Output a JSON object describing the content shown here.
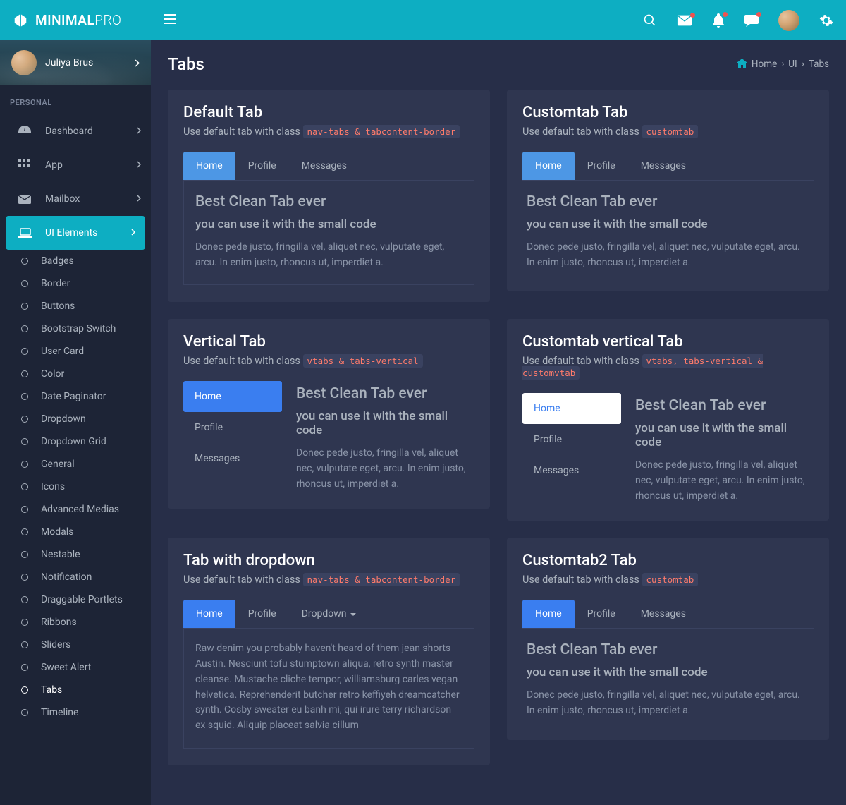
{
  "brand": {
    "text1": "MINIMAL",
    "text2": "PRO"
  },
  "user": {
    "name": "Juliya Brus"
  },
  "section_label": "PERSONAL",
  "nav": {
    "dashboard": "Dashboard",
    "app": "App",
    "mailbox": "Mailbox",
    "ui": "UI Elements"
  },
  "ui_children": [
    "Badges",
    "Border",
    "Buttons",
    "Bootstrap Switch",
    "User Card",
    "Color",
    "Date Paginator",
    "Dropdown",
    "Dropdown Grid",
    "General",
    "Icons",
    "Advanced Medias",
    "Modals",
    "Nestable",
    "Notification",
    "Draggable Portlets",
    "Ribbons",
    "Sliders",
    "Sweet Alert",
    "Tabs",
    "Timeline"
  ],
  "page": {
    "title": "Tabs"
  },
  "crumbs": {
    "home": "Home",
    "ui": "UI",
    "tabs": "Tabs"
  },
  "common": {
    "subprefix": "Use default tab with class ",
    "tab_home": "Home",
    "tab_profile": "Profile",
    "tab_messages": "Messages",
    "tab_dropdown": "Dropdown",
    "tc_h1": "Best Clean Tab ever",
    "tc_h2": "you can use it with the small code",
    "tc_p": "Donec pede justo, fringilla vel, aliquet nec, vulputate eget, arcu. In enim justo, rhoncus ut, imperdiet a."
  },
  "boxes": {
    "default": {
      "title": "Default Tab",
      "code": "nav-tabs & tabcontent-border"
    },
    "customtab": {
      "title": "Customtab Tab",
      "code": "customtab"
    },
    "vertical": {
      "title": "Vertical Tab",
      "code": "vtabs & tabs-vertical"
    },
    "custom_vertical": {
      "title": "Customtab vertical Tab",
      "code": "vtabs, tabs-vertical & customvtab"
    },
    "dropdown": {
      "title": "Tab with dropdown",
      "code": "nav-tabs & tabcontent-border",
      "body": "Raw denim you probably haven't heard of them jean shorts Austin. Nesciunt tofu stumptown aliqua, retro synth master cleanse. Mustache cliche tempor, williamsburg carles vegan helvetica. Reprehenderit butcher retro keffiyeh dreamcatcher synth. Cosby sweater eu banh mi, qui irure terry richardson ex squid. Aliquip placeat salvia cillum"
    },
    "customtab2": {
      "title": "Customtab2 Tab",
      "code": "customtab"
    }
  }
}
